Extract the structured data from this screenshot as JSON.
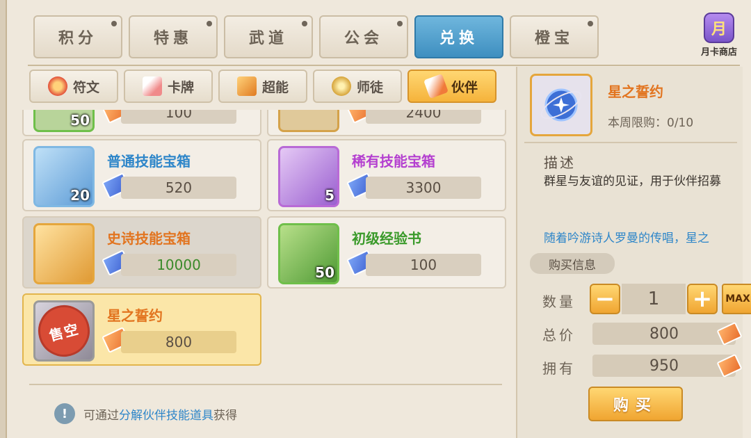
{
  "top_tabs": [
    {
      "label": "积分",
      "active": false
    },
    {
      "label": "特惠",
      "active": false
    },
    {
      "label": "武道",
      "active": false
    },
    {
      "label": "公会",
      "active": false
    },
    {
      "label": "兑换",
      "active": true
    },
    {
      "label": "橙宝",
      "active": false
    }
  ],
  "month_card": {
    "icon_char": "月",
    "label": "月卡商店"
  },
  "sub_tabs": [
    {
      "label": "符文",
      "icon": "rune-icon",
      "color": "#e2503a",
      "active": false
    },
    {
      "label": "卡牌",
      "icon": "card-icon",
      "color": "#f08a8a",
      "active": false
    },
    {
      "label": "超能",
      "icon": "cube-icon",
      "color": "#f0a030",
      "active": false
    },
    {
      "label": "师徒",
      "icon": "coin-icon",
      "color": "#d6a43a",
      "active": false
    },
    {
      "label": "伙伴",
      "icon": "ticket-icon",
      "color": "#f07a3a",
      "active": true
    }
  ],
  "partial_items": [
    {
      "qty": "50",
      "price": "100"
    },
    {
      "price": "2400"
    }
  ],
  "items": [
    {
      "name": "普通技能宝箱",
      "name_color": "#2e86c9",
      "qty": "20",
      "price": "520",
      "price_color": "#5a4f44",
      "icon": "common-chest-icon",
      "state": "normal"
    },
    {
      "name": "稀有技能宝箱",
      "name_color": "#b43fd0",
      "qty": "5",
      "price": "3300",
      "price_color": "#5a4f44",
      "icon": "rare-chest-icon",
      "state": "normal"
    },
    {
      "name": "史诗技能宝箱",
      "name_color": "#e2741f",
      "qty": "",
      "price": "10000",
      "price_color": "#3a8a2a",
      "icon": "epic-chest-icon",
      "state": "dim"
    },
    {
      "name": "初级经验书",
      "name_color": "#3a9a2a",
      "qty": "50",
      "price": "100",
      "price_color": "#5a4f44",
      "icon": "exp-book-icon",
      "state": "normal"
    },
    {
      "name": "星之誓约",
      "name_color": "#e2741f",
      "qty": "",
      "price": "800",
      "price_color": "#5a4f44",
      "icon": "star-oath-icon",
      "state": "selected",
      "sold_out": "售空"
    }
  ],
  "hint": {
    "prefix": "可通过",
    "highlight": "分解伙伴技能道具",
    "suffix": "获得"
  },
  "detail": {
    "name": "星之誓约",
    "limit": "本周限购：0/10",
    "desc_title": "描述",
    "desc_text": "群星与友谊的见证，用于伙伴招募",
    "lore_text": "随着吟游诗人罗曼的传唱，星之",
    "buy_info_label": "购买信息",
    "quantity_label": "数量",
    "quantity_value": "1",
    "minus": "−",
    "plus": "+",
    "max_label": "MAX",
    "total_label": "总价",
    "total_value": "800",
    "owned_label": "拥有",
    "owned_value": "950",
    "buy_label": "购买"
  }
}
